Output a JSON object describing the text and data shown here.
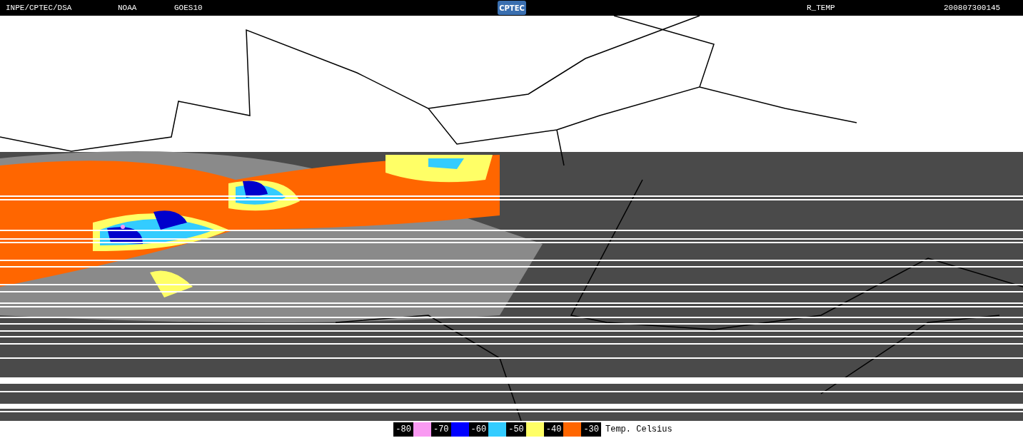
{
  "header": {
    "source": "INPE/CPTEC/DSA",
    "agency": "NOAA",
    "satellite": "GOES10",
    "logo": "CPTEC",
    "product": "R_TEMP",
    "timestamp": "200807300145"
  },
  "legend": {
    "items": [
      {
        "label": "-80",
        "color": "#f99af2"
      },
      {
        "label": "-70",
        "color": "#0000ff"
      },
      {
        "label": "-60",
        "color": "#33ccff"
      },
      {
        "label": "-50",
        "color": "#ffff66"
      },
      {
        "label": "-40",
        "color": "#ff6600"
      }
    ],
    "end_label": "-30",
    "unit": "Temp. Celsius"
  }
}
